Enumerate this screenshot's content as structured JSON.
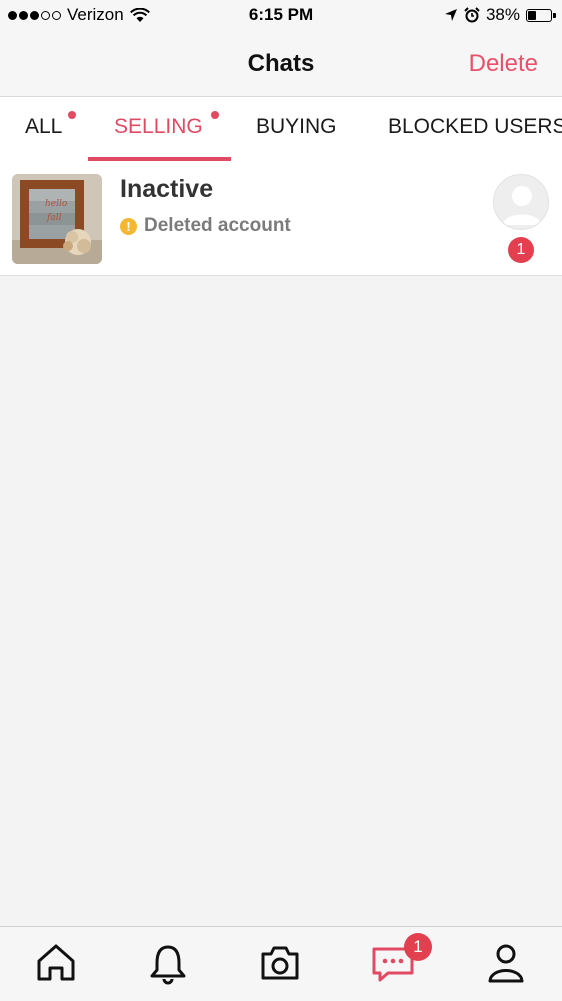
{
  "status_bar": {
    "carrier": "Verizon",
    "time": "6:15 PM",
    "battery": "38%",
    "signal_icon": "signal-dots-icon",
    "wifi_icon": "wifi-icon"
  },
  "header": {
    "title": "Chats",
    "delete_label": "Delete"
  },
  "tabs": [
    {
      "label": "ALL",
      "has_dot": true,
      "active": false
    },
    {
      "label": "SELLING",
      "has_dot": true,
      "active": true
    },
    {
      "label": "BUYING",
      "has_dot": false,
      "active": false
    },
    {
      "label": "BLOCKED USERS",
      "has_dot": false,
      "active": false
    }
  ],
  "chats": [
    {
      "title": "Inactive",
      "status": "Deleted account",
      "warning_icon": "!",
      "unread_count": "1",
      "thumbnail_icon": "product-photo",
      "avatar_icon": "user-placeholder-icon"
    }
  ],
  "tab_bar": {
    "items": [
      "home-icon",
      "bell-icon",
      "camera-icon",
      "chat-icon",
      "profile-icon"
    ],
    "chat_badge": "1"
  },
  "colors": {
    "accent": "#e14a63",
    "badge": "#e2404f",
    "warning": "#f4b731",
    "background": "#f4f3f4"
  }
}
